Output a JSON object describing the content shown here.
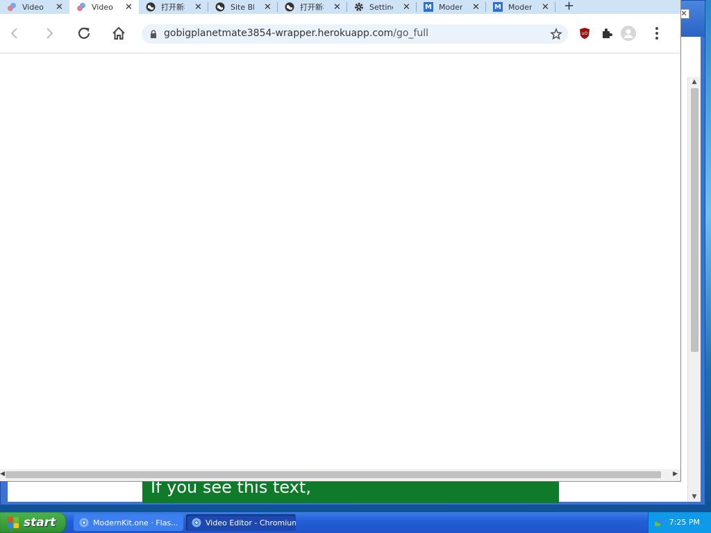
{
  "tabs": [
    {
      "title": "Video Editor",
      "favicon": "video-editor-icon",
      "active": false
    },
    {
      "title": "Video Editor",
      "favicon": "video-editor-icon",
      "active": true
    },
    {
      "title": "打开新标签页",
      "favicon": "globe-icon",
      "active": false
    },
    {
      "title": "Site Blocker",
      "favicon": "globe-icon",
      "active": false
    },
    {
      "title": "打开新标签页",
      "favicon": "globe-icon",
      "active": false
    },
    {
      "title": "Settings",
      "favicon": "gear-icon",
      "active": false
    },
    {
      "title": "ModernKit",
      "favicon": "m-icon",
      "active": false
    },
    {
      "title": "ModernKit",
      "favicon": "m-icon",
      "active": false
    }
  ],
  "new_tab_label": "+",
  "close_glyph": "✕",
  "address": {
    "domain": "gobigplanetmate3854-wrapper.herokuapp.com",
    "path": "/go_full"
  },
  "extensions": [
    "ublock-origin-icon",
    "puzzle-icon"
  ],
  "background_page": {
    "banner_text": "If you see this text,",
    "banner_color": "#0e7a2a"
  },
  "taskbar": {
    "start_label": "start",
    "tasks": [
      {
        "label": "ModernKit.one · Flas...",
        "icon": "chromium-icon"
      },
      {
        "label": "Video Editor - Chromium",
        "icon": "chromium-icon"
      }
    ],
    "clock": "7:25 PM"
  }
}
